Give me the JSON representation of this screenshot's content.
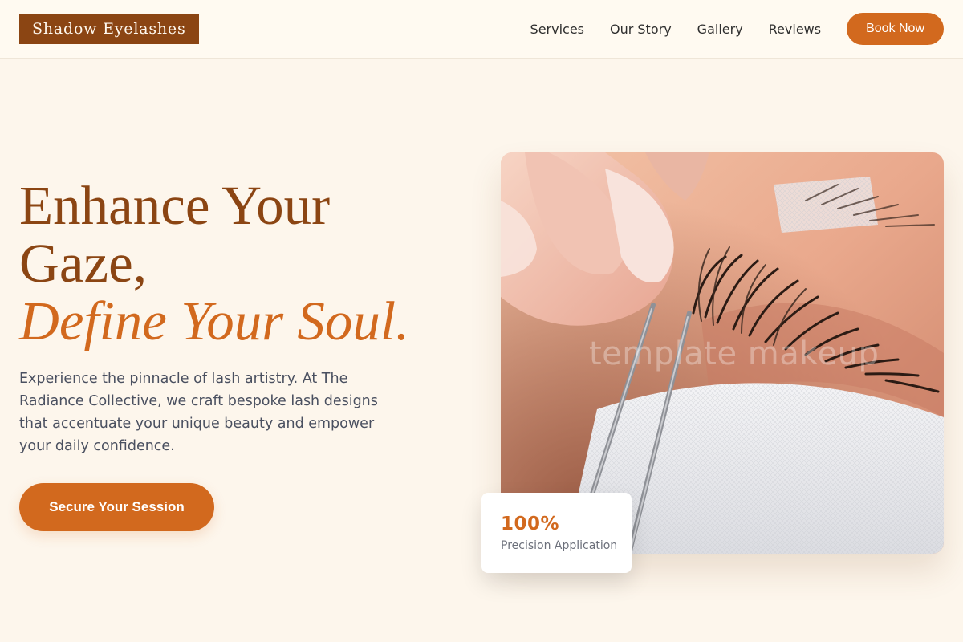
{
  "brand": {
    "name": "Shadow Eyelashes"
  },
  "nav": {
    "items": [
      {
        "label": "Services"
      },
      {
        "label": "Our Story"
      },
      {
        "label": "Gallery"
      },
      {
        "label": "Reviews"
      }
    ],
    "cta_label": "Book Now"
  },
  "hero": {
    "title_line1": "Enhance Your",
    "title_line2": "Gaze,",
    "title_accent": "Define Your Soul.",
    "description": "Experience the pinnacle of lash artistry. At The Radiance Collective, we craft bespoke lash designs that accentuate your unique beauty and empower your daily confidence.",
    "cta_label": "Secure Your Session",
    "image_watermark": "template makeup"
  },
  "stat": {
    "value": "100%",
    "label": "Precision Application"
  },
  "colors": {
    "background": "#fdf6ec",
    "brand_brown": "#8b4513",
    "accent_orange": "#d2691e",
    "body_text": "#4a5060"
  }
}
